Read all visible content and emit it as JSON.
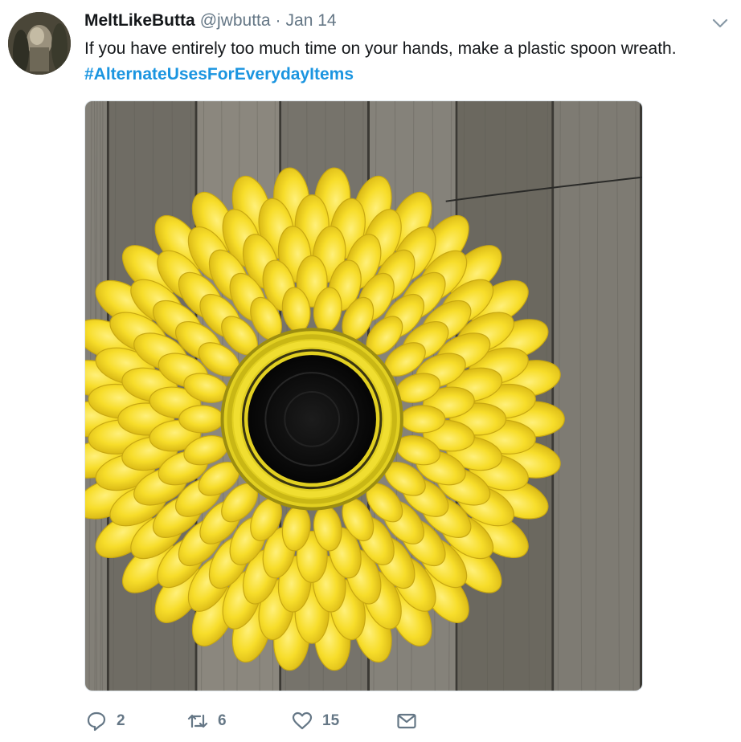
{
  "tweet": {
    "display_name": "MeltLikeButta",
    "handle": "@jwbutta",
    "separator": "·",
    "date": "Jan 14",
    "text": "If you have entirely too much time on your hands, make a plastic spoon wreath.",
    "hashtag": "#AlternateUsesForEverydayItems"
  },
  "actions": {
    "reply_count": "2",
    "retweet_count": "6",
    "like_count": "15"
  },
  "icons": {
    "caret": "chevron-down-icon",
    "reply": "reply-icon",
    "retweet": "retweet-icon",
    "like": "heart-icon",
    "message": "envelope-icon"
  },
  "colors": {
    "text": "#14171a",
    "secondary": "#657786",
    "link": "#1b95e0",
    "spoon_yellow": "#f7e030",
    "wreath_center": "#101010",
    "fence": "#7d7a72"
  }
}
